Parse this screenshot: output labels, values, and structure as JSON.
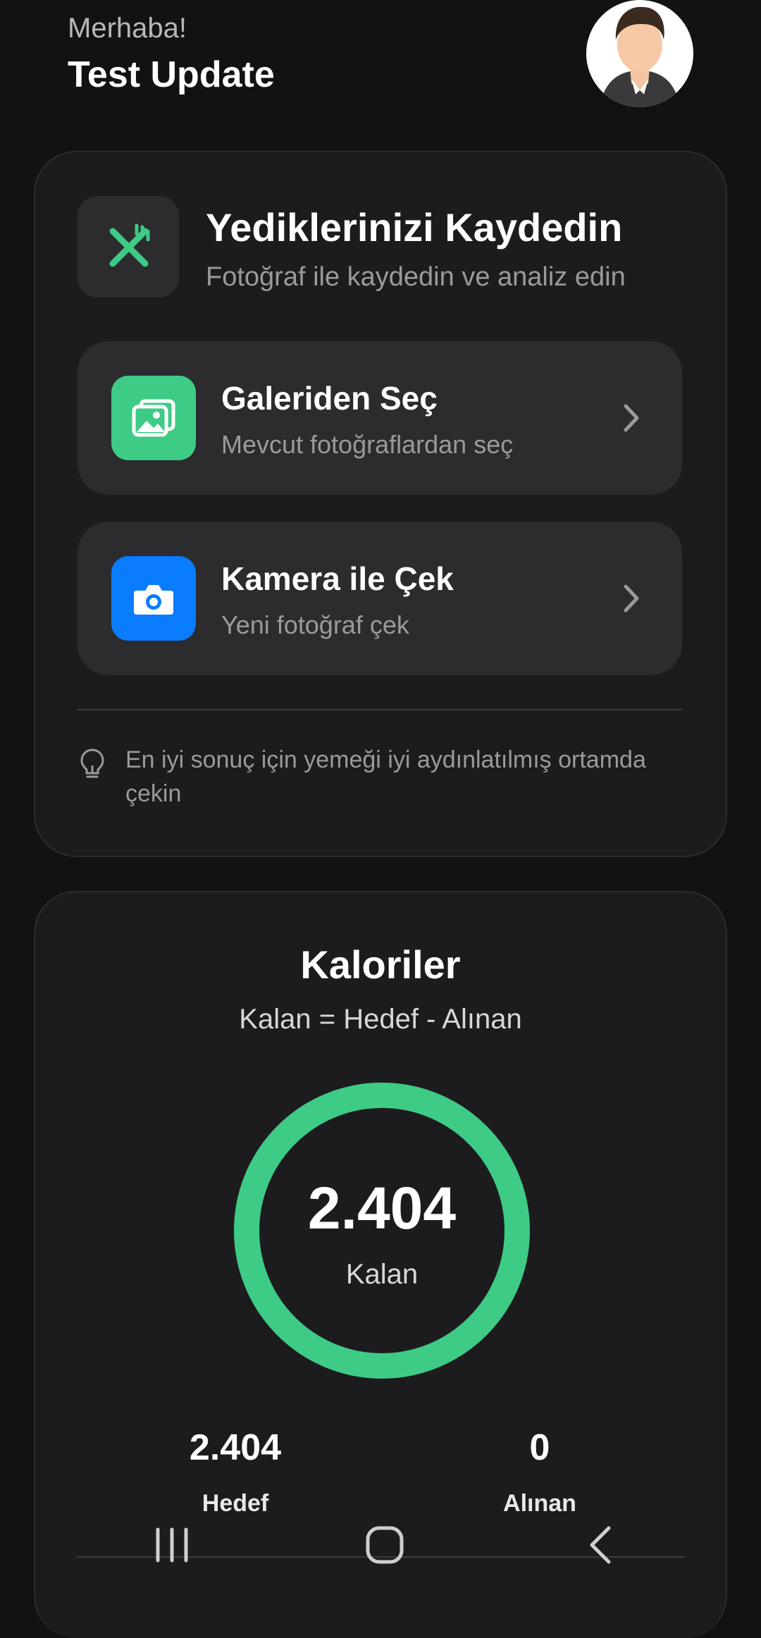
{
  "header": {
    "greeting": "Merhaba!",
    "user_name": "Test Update"
  },
  "log_card": {
    "title": "Yediklerinizi Kaydedin",
    "subtitle": "Fotoğraf ile kaydedin ve analiz edin",
    "icon": "fork-knife-icon",
    "options": [
      {
        "title": "Galeriden Seç",
        "subtitle": "Mevcut fotoğraflardan seç",
        "icon": "gallery-icon",
        "color": "#3ecb86"
      },
      {
        "title": "Kamera ile Çek",
        "subtitle": "Yeni fotoğraf çek",
        "icon": "camera-icon",
        "color": "#0a7cff"
      }
    ],
    "tip": "En iyi sonuç için yemeği iyi aydınlatılmış ortamda çekin"
  },
  "calories": {
    "title": "Kaloriler",
    "formula": "Kalan = Hedef - Alınan",
    "remaining_value": "2.404",
    "remaining_label": "Kalan",
    "target_value": "2.404",
    "target_label": "Hedef",
    "taken_value": "0",
    "taken_label": "Alınan",
    "ring_color": "#3ecb86",
    "ring_progress": 1.0
  },
  "colors": {
    "background": "#121212",
    "card": "#1c1c1e",
    "accent_green": "#3ecb86",
    "accent_blue": "#0a7cff"
  }
}
